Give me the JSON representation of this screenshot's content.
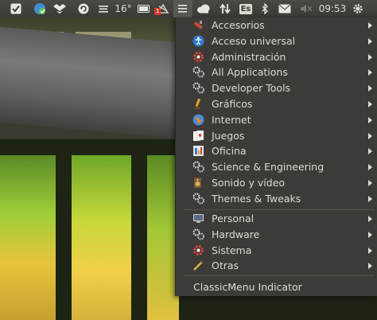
{
  "panel": {
    "temperature": "16°",
    "time": "09:53",
    "keyboard_layout": "Es",
    "badge_count": "1",
    "icons": [
      "checkbox-indicator-icon",
      "cloud-sync-icon",
      "dropbox-icon",
      "update-icon",
      "weather-icon",
      "battery-icon",
      "mail-notify-icon",
      "classicmenu-icon",
      "cloud-icon",
      "network-icon",
      "keyboard-icon",
      "bluetooth-icon",
      "envelope-icon",
      "volume-muted-icon",
      "gear-icon"
    ]
  },
  "menu": {
    "items": [
      {
        "label": "Accesorios",
        "icon": "accessories-icon"
      },
      {
        "label": "Acceso universal",
        "icon": "universal-access-icon"
      },
      {
        "label": "Administración",
        "icon": "administration-icon"
      },
      {
        "label": "All Applications",
        "icon": "all-applications-icon"
      },
      {
        "label": "Developer Tools",
        "icon": "developer-tools-icon"
      },
      {
        "label": "Gráficos",
        "icon": "graphics-icon"
      },
      {
        "label": "Internet",
        "icon": "internet-icon"
      },
      {
        "label": "Juegos",
        "icon": "games-icon"
      },
      {
        "label": "Oficina",
        "icon": "office-icon"
      },
      {
        "label": "Science & Engineering",
        "icon": "science-icon"
      },
      {
        "label": "Sonido y vídeo",
        "icon": "sound-video-icon"
      },
      {
        "label": "Themes & Tweaks",
        "icon": "themes-icon"
      }
    ],
    "items2": [
      {
        "label": "Personal",
        "icon": "personal-icon"
      },
      {
        "label": "Hardware",
        "icon": "hardware-icon"
      },
      {
        "label": "Sistema",
        "icon": "system-icon"
      },
      {
        "label": "Otras",
        "icon": "other-icon"
      }
    ],
    "footer": "ClassicMenu Indicator"
  }
}
